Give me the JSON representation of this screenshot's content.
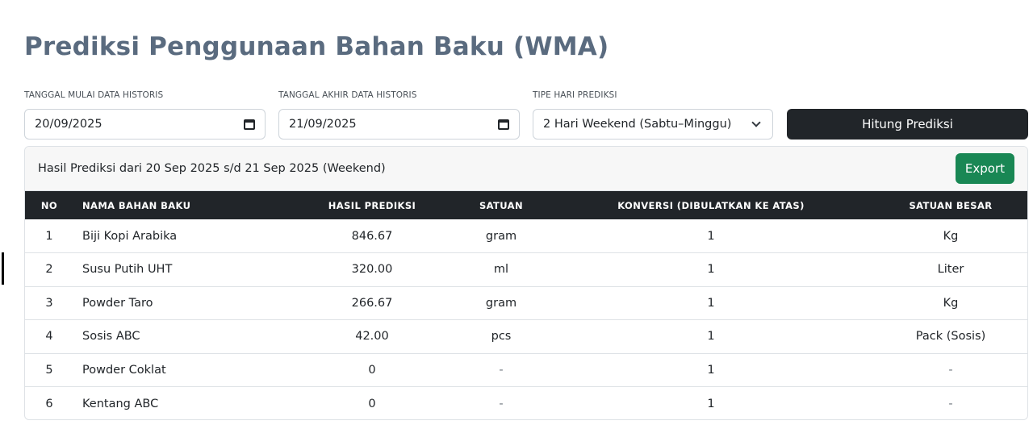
{
  "page": {
    "title": "Prediksi Penggunaan Bahan Baku (WMA)"
  },
  "filters": {
    "start_label": "TANGGAL MULAI DATA HISTORIS",
    "start_value": "20/09/2025",
    "end_label": "TANGGAL AKHIR DATA HISTORIS",
    "end_value": "21/09/2025",
    "type_label": "TIPE HARI PREDIKSI",
    "type_value": "2 Hari Weekend (Sabtu–Minggu)",
    "submit_label": "Hitung Prediksi"
  },
  "result": {
    "title": "Hasil Prediksi dari 20 Sep 2025 s/d 21 Sep 2025 (Weekend)",
    "export_label": "Export",
    "columns": [
      "NO",
      "NAMA BAHAN BAKU",
      "HASIL PREDIKSI",
      "SATUAN",
      "KONVERSI (DIBULATKAN KE ATAS)",
      "SATUAN BESAR"
    ],
    "rows": [
      [
        "1",
        "Biji Kopi Arabika",
        "846.67",
        "gram",
        "1",
        "Kg"
      ],
      [
        "2",
        "Susu Putih UHT",
        "320.00",
        "ml",
        "1",
        "Liter"
      ],
      [
        "3",
        "Powder Taro",
        "266.67",
        "gram",
        "1",
        "Kg"
      ],
      [
        "4",
        "Sosis ABC",
        "42.00",
        "pcs",
        "1",
        "Pack (Sosis)"
      ],
      [
        "5",
        "Powder Coklat",
        "0",
        "-",
        "1",
        "-"
      ],
      [
        "6",
        "Kentang ABC",
        "0",
        "-",
        "1",
        "-"
      ]
    ]
  },
  "colors": {
    "title": "#5a6b7f",
    "primary_dark": "#212529",
    "success": "#198754"
  },
  "icons": {
    "date": "calendar-icon",
    "select": "chevron-down-icon"
  }
}
